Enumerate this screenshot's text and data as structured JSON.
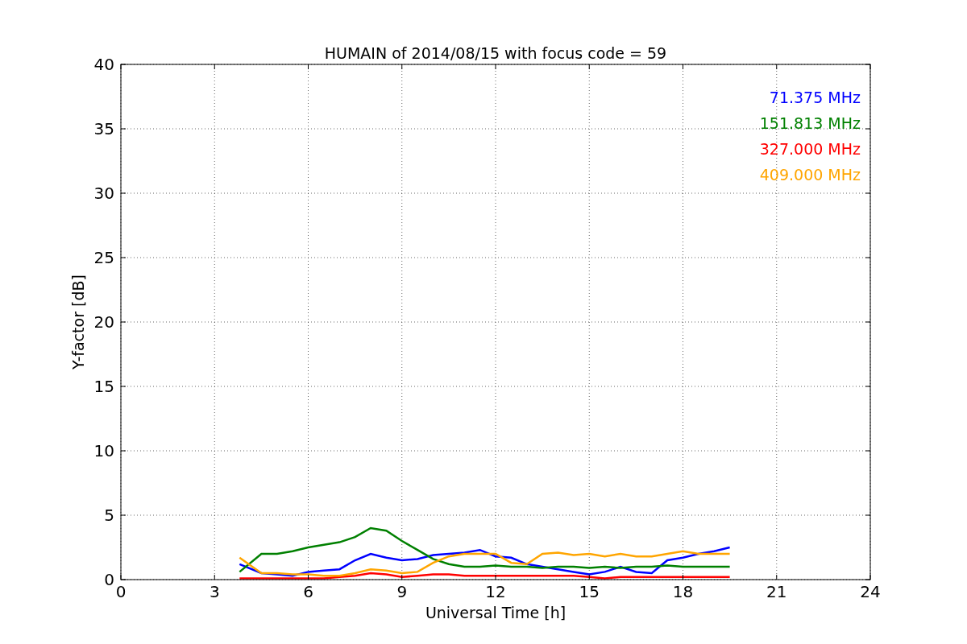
{
  "chart_data": {
    "type": "line",
    "title": "HUMAIN of 2014/08/15 with focus code = 59",
    "xlabel": "Universal Time [h]",
    "ylabel": "Y-factor [dB]",
    "x": [
      3.8,
      4.5,
      5,
      5.5,
      6,
      6.5,
      7,
      7.5,
      8,
      8.5,
      9,
      9.5,
      10,
      10.5,
      11,
      11.5,
      12,
      12.5,
      13,
      13.5,
      14,
      14.5,
      15,
      15.5,
      16,
      16.5,
      17,
      17.5,
      18,
      18.5,
      19,
      19.5
    ],
    "series": [
      {
        "name": "71.375 MHz",
        "color": "#0000ff",
        "values": [
          1.2,
          0.5,
          0.4,
          0.3,
          0.6,
          0.7,
          0.8,
          1.5,
          2.0,
          1.7,
          1.5,
          1.6,
          1.9,
          2.0,
          2.1,
          2.3,
          1.8,
          1.7,
          1.2,
          1.0,
          0.8,
          0.6,
          0.4,
          0.6,
          1.0,
          0.6,
          0.5,
          1.5,
          1.7,
          2.0,
          2.2,
          2.5
        ]
      },
      {
        "name": "151.813 MHz",
        "color": "#008000",
        "values": [
          0.6,
          2.0,
          2.0,
          2.2,
          2.5,
          2.7,
          2.9,
          3.3,
          4.0,
          3.8,
          3.0,
          2.3,
          1.6,
          1.2,
          1.0,
          1.0,
          1.1,
          1.0,
          1.0,
          0.9,
          1.0,
          1.0,
          0.9,
          1.0,
          0.9,
          1.0,
          1.0,
          1.1,
          1.0,
          1.0,
          1.0,
          1.0
        ]
      },
      {
        "name": "327.000 MHz",
        "color": "#ff0000",
        "values": [
          0.1,
          0.1,
          0.1,
          0.1,
          0.1,
          0.1,
          0.2,
          0.3,
          0.5,
          0.4,
          0.2,
          0.3,
          0.4,
          0.4,
          0.3,
          0.3,
          0.3,
          0.3,
          0.3,
          0.3,
          0.3,
          0.3,
          0.2,
          0.1,
          0.2,
          0.2,
          0.2,
          0.2,
          0.2,
          0.2,
          0.2,
          0.2
        ]
      },
      {
        "name": "409.000 MHz",
        "color": "#ffa500",
        "values": [
          1.7,
          0.5,
          0.5,
          0.4,
          0.4,
          0.3,
          0.3,
          0.5,
          0.8,
          0.7,
          0.5,
          0.6,
          1.3,
          1.8,
          2.0,
          2.0,
          2.0,
          1.3,
          1.2,
          2.0,
          2.1,
          1.9,
          2.0,
          1.8,
          2.0,
          1.8,
          1.8,
          2.0,
          2.2,
          2.0,
          2.0,
          2.0
        ]
      }
    ],
    "xlim": [
      0,
      24
    ],
    "ylim": [
      0,
      40
    ],
    "xticks": [
      0,
      3,
      6,
      9,
      12,
      15,
      18,
      21,
      24
    ],
    "yticks": [
      0,
      5,
      10,
      15,
      20,
      25,
      30,
      35,
      40
    ],
    "grid": true
  }
}
